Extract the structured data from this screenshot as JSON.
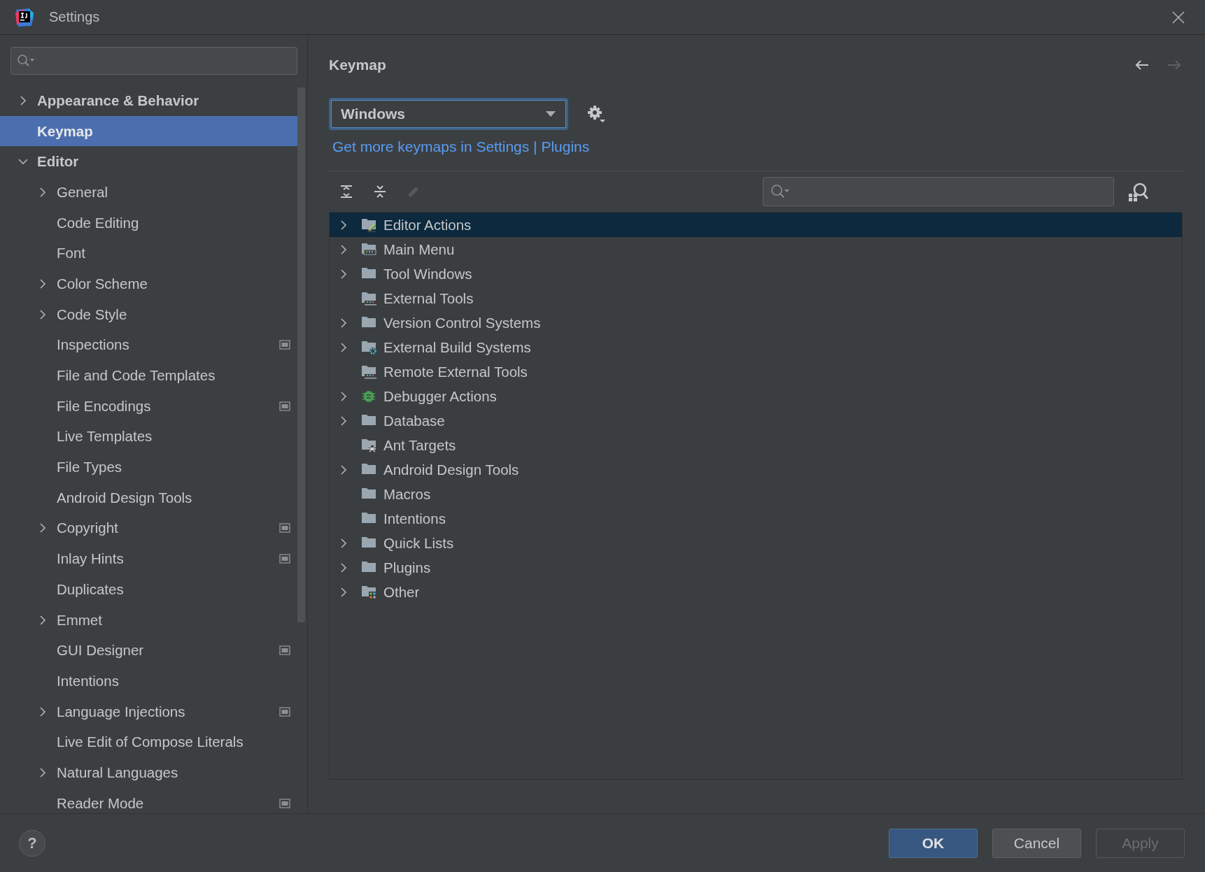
{
  "window": {
    "title": "Settings"
  },
  "sidebar": {
    "items": [
      {
        "label": "Appearance & Behavior",
        "expanded": false,
        "selected": false,
        "scope_icon": false
      },
      {
        "label": "Keymap",
        "selected": true,
        "scope_icon": false
      },
      {
        "label": "Editor",
        "expanded": true,
        "selected": false,
        "scope_icon": false,
        "children": [
          {
            "label": "General",
            "expanded": false,
            "selected": false,
            "scope_icon": false
          },
          {
            "label": "Code Editing",
            "selected": false,
            "scope_icon": false
          },
          {
            "label": "Font",
            "selected": false,
            "scope_icon": false
          },
          {
            "label": "Color Scheme",
            "expanded": false,
            "selected": false,
            "scope_icon": false
          },
          {
            "label": "Code Style",
            "expanded": false,
            "selected": false,
            "scope_icon": false
          },
          {
            "label": "Inspections",
            "selected": false,
            "scope_icon": true
          },
          {
            "label": "File and Code Templates",
            "selected": false,
            "scope_icon": false
          },
          {
            "label": "File Encodings",
            "selected": false,
            "scope_icon": true
          },
          {
            "label": "Live Templates",
            "selected": false,
            "scope_icon": false
          },
          {
            "label": "File Types",
            "selected": false,
            "scope_icon": false
          },
          {
            "label": "Android Design Tools",
            "selected": false,
            "scope_icon": false
          },
          {
            "label": "Copyright",
            "expanded": false,
            "selected": false,
            "scope_icon": true
          },
          {
            "label": "Inlay Hints",
            "selected": false,
            "scope_icon": true
          },
          {
            "label": "Duplicates",
            "selected": false,
            "scope_icon": false
          },
          {
            "label": "Emmet",
            "expanded": false,
            "selected": false,
            "scope_icon": false
          },
          {
            "label": "GUI Designer",
            "selected": false,
            "scope_icon": true
          },
          {
            "label": "Intentions",
            "selected": false,
            "scope_icon": false
          },
          {
            "label": "Language Injections",
            "expanded": false,
            "selected": false,
            "scope_icon": true
          },
          {
            "label": "Live Edit of Compose Literals",
            "selected": false,
            "scope_icon": false
          },
          {
            "label": "Natural Languages",
            "expanded": false,
            "selected": false,
            "scope_icon": false
          },
          {
            "label": "Reader Mode",
            "selected": false,
            "scope_icon": true
          }
        ]
      }
    ]
  },
  "page": {
    "title": "Keymap",
    "nav": [
      {
        "kind": "back",
        "disabled": false
      },
      {
        "kind": "forward",
        "disabled": true
      }
    ],
    "keymap_select": {
      "value": "Windows"
    },
    "link": "Get more keymaps in Settings | Plugins",
    "toolbar": [
      {
        "kind": "expand-all",
        "disabled": false
      },
      {
        "kind": "collapse-all",
        "disabled": false
      },
      {
        "kind": "edit",
        "disabled": true
      }
    ],
    "tree": [
      {
        "label": "Editor Actions",
        "kind": "editor-actions",
        "expanded": false,
        "selected": true
      },
      {
        "label": "Main Menu",
        "kind": "menu",
        "expanded": false,
        "selected": false
      },
      {
        "label": "Tool Windows",
        "kind": "folder",
        "expanded": false,
        "selected": false
      },
      {
        "label": "External Tools",
        "kind": "tools",
        "selected": false
      },
      {
        "label": "Version Control Systems",
        "kind": "folder",
        "expanded": false,
        "selected": false
      },
      {
        "label": "External Build Systems",
        "kind": "build",
        "expanded": false,
        "selected": false
      },
      {
        "label": "Remote External Tools",
        "kind": "tools",
        "selected": false
      },
      {
        "label": "Debugger Actions",
        "kind": "debugger",
        "expanded": false,
        "selected": false
      },
      {
        "label": "Database",
        "kind": "folder",
        "expanded": false,
        "selected": false
      },
      {
        "label": "Ant Targets",
        "kind": "ant",
        "selected": false
      },
      {
        "label": "Android Design Tools",
        "kind": "folder",
        "expanded": false,
        "selected": false
      },
      {
        "label": "Macros",
        "kind": "folder",
        "selected": false
      },
      {
        "label": "Intentions",
        "kind": "folder",
        "selected": false
      },
      {
        "label": "Quick Lists",
        "kind": "folder",
        "expanded": false,
        "selected": false
      },
      {
        "label": "Plugins",
        "kind": "folder",
        "expanded": false,
        "selected": false
      },
      {
        "label": "Other",
        "kind": "other",
        "expanded": false,
        "selected": false
      }
    ]
  },
  "footer": {
    "help": "?",
    "buttons": [
      {
        "label": "OK",
        "kind": "primary",
        "disabled": false
      },
      {
        "label": "Cancel",
        "kind": "normal",
        "disabled": false
      },
      {
        "label": "Apply",
        "kind": "normal",
        "disabled": true
      }
    ]
  }
}
